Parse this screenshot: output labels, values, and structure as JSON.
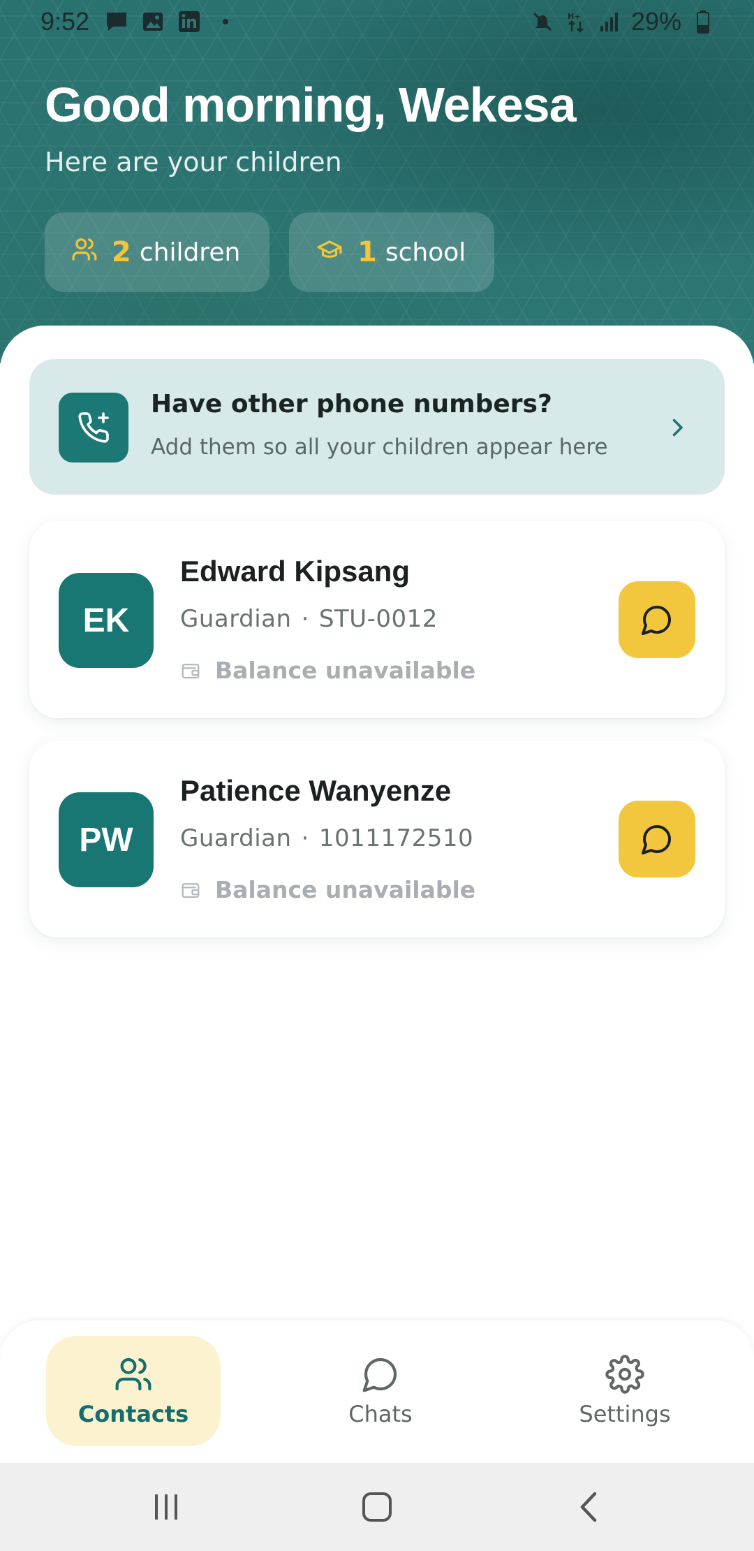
{
  "status_bar": {
    "time": "9:52",
    "battery": "29%",
    "left_icons": [
      "message-icon",
      "image-icon",
      "linkedin-icon",
      "dot-icon"
    ],
    "right_icons": [
      "mute-icon",
      "data-icon",
      "signal-icon",
      "battery-icon"
    ]
  },
  "header": {
    "greeting": "Good morning, Wekesa",
    "subtitle": "Here are your children",
    "stats": [
      {
        "icon": "people-icon",
        "count": "2",
        "label": "children"
      },
      {
        "icon": "graduation-cap-icon",
        "count": "1",
        "label": "school"
      }
    ]
  },
  "banner": {
    "icon": "phone-add-icon",
    "title": "Have other phone numbers?",
    "subtitle": "Add them so all your children appear here"
  },
  "children": [
    {
      "initials": "EK",
      "name": "Edward Kipsang",
      "role": "Guardian",
      "id": "STU-0012",
      "balance": "Balance unavailable"
    },
    {
      "initials": "PW",
      "name": "Patience Wanyenze",
      "role": "Guardian",
      "id": "1011172510",
      "balance": "Balance unavailable"
    }
  ],
  "separator": "·",
  "bottom_nav": {
    "items": [
      {
        "label": "Contacts",
        "icon": "contacts-icon",
        "active": true
      },
      {
        "label": "Chats",
        "icon": "chat-bubble-icon",
        "active": false
      },
      {
        "label": "Settings",
        "icon": "gear-icon",
        "active": false
      }
    ]
  },
  "colors": {
    "primary": "#187673",
    "accent": "#f3c73d",
    "banner_bg": "#d8e9ea",
    "active_nav_bg": "#fcf2cf"
  }
}
